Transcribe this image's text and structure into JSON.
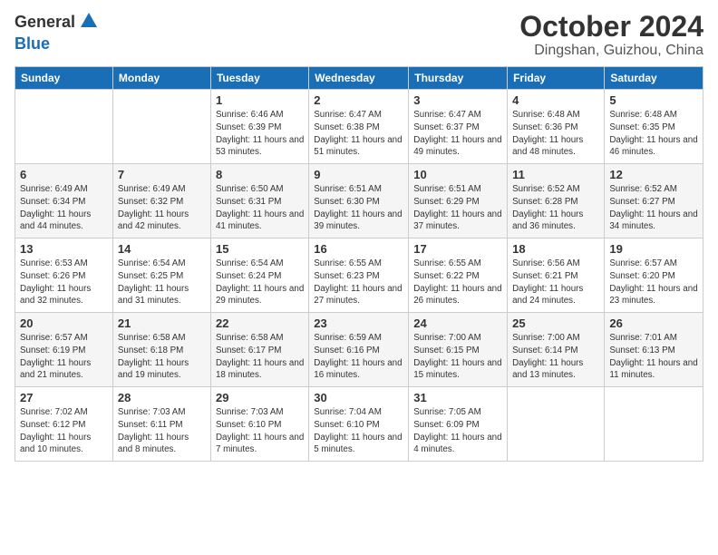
{
  "logo": {
    "general": "General",
    "blue": "Blue"
  },
  "title": "October 2024",
  "subtitle": "Dingshan, Guizhou, China",
  "weekdays": [
    "Sunday",
    "Monday",
    "Tuesday",
    "Wednesday",
    "Thursday",
    "Friday",
    "Saturday"
  ],
  "weeks": [
    [
      {
        "day": "",
        "sunrise": "",
        "sunset": "",
        "daylight": ""
      },
      {
        "day": "",
        "sunrise": "",
        "sunset": "",
        "daylight": ""
      },
      {
        "day": "1",
        "sunrise": "Sunrise: 6:46 AM",
        "sunset": "Sunset: 6:39 PM",
        "daylight": "Daylight: 11 hours and 53 minutes."
      },
      {
        "day": "2",
        "sunrise": "Sunrise: 6:47 AM",
        "sunset": "Sunset: 6:38 PM",
        "daylight": "Daylight: 11 hours and 51 minutes."
      },
      {
        "day": "3",
        "sunrise": "Sunrise: 6:47 AM",
        "sunset": "Sunset: 6:37 PM",
        "daylight": "Daylight: 11 hours and 49 minutes."
      },
      {
        "day": "4",
        "sunrise": "Sunrise: 6:48 AM",
        "sunset": "Sunset: 6:36 PM",
        "daylight": "Daylight: 11 hours and 48 minutes."
      },
      {
        "day": "5",
        "sunrise": "Sunrise: 6:48 AM",
        "sunset": "Sunset: 6:35 PM",
        "daylight": "Daylight: 11 hours and 46 minutes."
      }
    ],
    [
      {
        "day": "6",
        "sunrise": "Sunrise: 6:49 AM",
        "sunset": "Sunset: 6:34 PM",
        "daylight": "Daylight: 11 hours and 44 minutes."
      },
      {
        "day": "7",
        "sunrise": "Sunrise: 6:49 AM",
        "sunset": "Sunset: 6:32 PM",
        "daylight": "Daylight: 11 hours and 42 minutes."
      },
      {
        "day": "8",
        "sunrise": "Sunrise: 6:50 AM",
        "sunset": "Sunset: 6:31 PM",
        "daylight": "Daylight: 11 hours and 41 minutes."
      },
      {
        "day": "9",
        "sunrise": "Sunrise: 6:51 AM",
        "sunset": "Sunset: 6:30 PM",
        "daylight": "Daylight: 11 hours and 39 minutes."
      },
      {
        "day": "10",
        "sunrise": "Sunrise: 6:51 AM",
        "sunset": "Sunset: 6:29 PM",
        "daylight": "Daylight: 11 hours and 37 minutes."
      },
      {
        "day": "11",
        "sunrise": "Sunrise: 6:52 AM",
        "sunset": "Sunset: 6:28 PM",
        "daylight": "Daylight: 11 hours and 36 minutes."
      },
      {
        "day": "12",
        "sunrise": "Sunrise: 6:52 AM",
        "sunset": "Sunset: 6:27 PM",
        "daylight": "Daylight: 11 hours and 34 minutes."
      }
    ],
    [
      {
        "day": "13",
        "sunrise": "Sunrise: 6:53 AM",
        "sunset": "Sunset: 6:26 PM",
        "daylight": "Daylight: 11 hours and 32 minutes."
      },
      {
        "day": "14",
        "sunrise": "Sunrise: 6:54 AM",
        "sunset": "Sunset: 6:25 PM",
        "daylight": "Daylight: 11 hours and 31 minutes."
      },
      {
        "day": "15",
        "sunrise": "Sunrise: 6:54 AM",
        "sunset": "Sunset: 6:24 PM",
        "daylight": "Daylight: 11 hours and 29 minutes."
      },
      {
        "day": "16",
        "sunrise": "Sunrise: 6:55 AM",
        "sunset": "Sunset: 6:23 PM",
        "daylight": "Daylight: 11 hours and 27 minutes."
      },
      {
        "day": "17",
        "sunrise": "Sunrise: 6:55 AM",
        "sunset": "Sunset: 6:22 PM",
        "daylight": "Daylight: 11 hours and 26 minutes."
      },
      {
        "day": "18",
        "sunrise": "Sunrise: 6:56 AM",
        "sunset": "Sunset: 6:21 PM",
        "daylight": "Daylight: 11 hours and 24 minutes."
      },
      {
        "day": "19",
        "sunrise": "Sunrise: 6:57 AM",
        "sunset": "Sunset: 6:20 PM",
        "daylight": "Daylight: 11 hours and 23 minutes."
      }
    ],
    [
      {
        "day": "20",
        "sunrise": "Sunrise: 6:57 AM",
        "sunset": "Sunset: 6:19 PM",
        "daylight": "Daylight: 11 hours and 21 minutes."
      },
      {
        "day": "21",
        "sunrise": "Sunrise: 6:58 AM",
        "sunset": "Sunset: 6:18 PM",
        "daylight": "Daylight: 11 hours and 19 minutes."
      },
      {
        "day": "22",
        "sunrise": "Sunrise: 6:58 AM",
        "sunset": "Sunset: 6:17 PM",
        "daylight": "Daylight: 11 hours and 18 minutes."
      },
      {
        "day": "23",
        "sunrise": "Sunrise: 6:59 AM",
        "sunset": "Sunset: 6:16 PM",
        "daylight": "Daylight: 11 hours and 16 minutes."
      },
      {
        "day": "24",
        "sunrise": "Sunrise: 7:00 AM",
        "sunset": "Sunset: 6:15 PM",
        "daylight": "Daylight: 11 hours and 15 minutes."
      },
      {
        "day": "25",
        "sunrise": "Sunrise: 7:00 AM",
        "sunset": "Sunset: 6:14 PM",
        "daylight": "Daylight: 11 hours and 13 minutes."
      },
      {
        "day": "26",
        "sunrise": "Sunrise: 7:01 AM",
        "sunset": "Sunset: 6:13 PM",
        "daylight": "Daylight: 11 hours and 11 minutes."
      }
    ],
    [
      {
        "day": "27",
        "sunrise": "Sunrise: 7:02 AM",
        "sunset": "Sunset: 6:12 PM",
        "daylight": "Daylight: 11 hours and 10 minutes."
      },
      {
        "day": "28",
        "sunrise": "Sunrise: 7:03 AM",
        "sunset": "Sunset: 6:11 PM",
        "daylight": "Daylight: 11 hours and 8 minutes."
      },
      {
        "day": "29",
        "sunrise": "Sunrise: 7:03 AM",
        "sunset": "Sunset: 6:10 PM",
        "daylight": "Daylight: 11 hours and 7 minutes."
      },
      {
        "day": "30",
        "sunrise": "Sunrise: 7:04 AM",
        "sunset": "Sunset: 6:10 PM",
        "daylight": "Daylight: 11 hours and 5 minutes."
      },
      {
        "day": "31",
        "sunrise": "Sunrise: 7:05 AM",
        "sunset": "Sunset: 6:09 PM",
        "daylight": "Daylight: 11 hours and 4 minutes."
      },
      {
        "day": "",
        "sunrise": "",
        "sunset": "",
        "daylight": ""
      },
      {
        "day": "",
        "sunrise": "",
        "sunset": "",
        "daylight": ""
      }
    ]
  ]
}
